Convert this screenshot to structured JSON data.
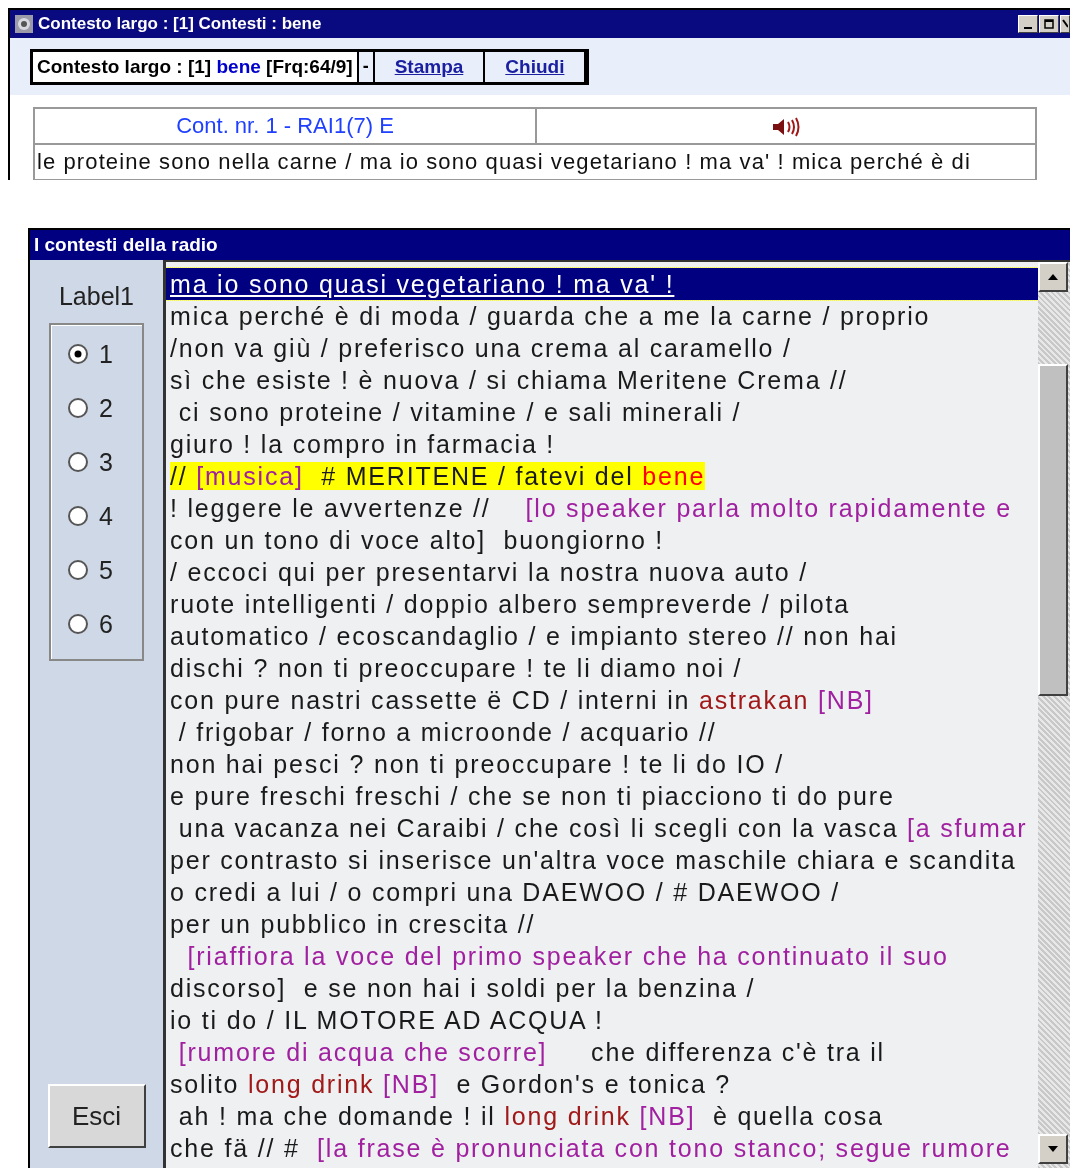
{
  "top_window": {
    "title": "Contesto largo : [1] Contesti : bene",
    "toolbar": {
      "title": "Contesto largo : [1]",
      "word": "bene",
      "frequency": "[Frq:64/9]",
      "separator": "-",
      "links": [
        "Stampa",
        "Chiudi"
      ]
    },
    "table": {
      "context_number": "Cont. nr. 1 - RAI1(7) E",
      "text": "le proteine sono nella carne / ma io sono quasi vegetariano ! ma va' ! mica perché è di"
    }
  },
  "radio_window": {
    "title": "I contesti della radio",
    "group_label": "Label1",
    "options": [
      {
        "label": "1",
        "selected": true
      },
      {
        "label": "2",
        "selected": false
      },
      {
        "label": "3",
        "selected": false
      },
      {
        "label": "4",
        "selected": false
      },
      {
        "label": "5",
        "selected": false
      },
      {
        "label": "6",
        "selected": false
      }
    ],
    "exit_button": "Esci",
    "lines": [
      {
        "selected": true,
        "highlighted": false,
        "segments": [
          {
            "kind": "text",
            "text": "ma io sono quasi vegetariano ! ma va' !"
          }
        ]
      },
      {
        "selected": false,
        "highlighted": false,
        "segments": [
          {
            "kind": "text",
            "text": "mica perché è di moda / guarda che a me la carne / proprio"
          }
        ]
      },
      {
        "selected": false,
        "highlighted": false,
        "segments": [
          {
            "kind": "text",
            "text": "/non va giù / preferisco una crema al caramello /"
          }
        ]
      },
      {
        "selected": false,
        "highlighted": false,
        "segments": [
          {
            "kind": "text",
            "text": "sì che esiste ! è nuova / si chiama Meritene Crema //"
          }
        ]
      },
      {
        "selected": false,
        "highlighted": false,
        "segments": [
          {
            "kind": "text",
            "text": " ci sono proteine / vitamine / e sali minerali /"
          }
        ]
      },
      {
        "selected": false,
        "highlighted": false,
        "segments": [
          {
            "kind": "text",
            "text": "giuro ! la compro in farmacia !"
          }
        ]
      },
      {
        "selected": false,
        "highlighted": true,
        "segments": [
          {
            "kind": "text",
            "text": "// "
          },
          {
            "kind": "note",
            "text": "[musica]"
          },
          {
            "kind": "text",
            "text": "  # MERITENE / fatevi del "
          },
          {
            "kind": "match",
            "text": "bene"
          }
        ]
      },
      {
        "selected": false,
        "highlighted": false,
        "segments": [
          {
            "kind": "text",
            "text": "! leggere le avvertenze //    "
          },
          {
            "kind": "note",
            "text": "[lo speaker parla molto rapidamente e"
          }
        ]
      },
      {
        "selected": false,
        "highlighted": false,
        "segments": [
          {
            "kind": "text",
            "text": "con un tono di voce alto]  buongiorno !"
          }
        ]
      },
      {
        "selected": false,
        "highlighted": false,
        "segments": [
          {
            "kind": "text",
            "text": "/ eccoci qui per presentarvi la nostra nuova auto /"
          }
        ]
      },
      {
        "selected": false,
        "highlighted": false,
        "segments": [
          {
            "kind": "text",
            "text": "ruote intelligenti / doppio albero sempreverde / pilota"
          }
        ]
      },
      {
        "selected": false,
        "highlighted": false,
        "segments": [
          {
            "kind": "text",
            "text": "automatico / ecoscandaglio / e impianto stereo // non hai"
          }
        ]
      },
      {
        "selected": false,
        "highlighted": false,
        "segments": [
          {
            "kind": "text",
            "text": "dischi ? non ti preoccupare ! te li diamo noi /"
          }
        ]
      },
      {
        "selected": false,
        "highlighted": false,
        "segments": [
          {
            "kind": "text",
            "text": "con pure nastri cassette ë CD / interni in "
          },
          {
            "kind": "term",
            "text": "astrakan"
          },
          {
            "kind": "note",
            "text": " [NB]"
          }
        ]
      },
      {
        "selected": false,
        "highlighted": false,
        "segments": [
          {
            "kind": "text",
            "text": " / frigobar / forno a microonde / acquario //"
          }
        ]
      },
      {
        "selected": false,
        "highlighted": false,
        "segments": [
          {
            "kind": "text",
            "text": "non hai pesci ? non ti preoccupare ! te li do IO /"
          }
        ]
      },
      {
        "selected": false,
        "highlighted": false,
        "segments": [
          {
            "kind": "text",
            "text": "e pure freschi freschi / che se non ti piacciono ti do pure"
          }
        ]
      },
      {
        "selected": false,
        "highlighted": false,
        "segments": [
          {
            "kind": "text",
            "text": " una vacanza nei Caraibi / che così li scegli con la vasca "
          },
          {
            "kind": "note",
            "text": "[a sfumar"
          }
        ]
      },
      {
        "selected": false,
        "highlighted": false,
        "segments": [
          {
            "kind": "text",
            "text": "per contrasto si inserisce un'altra voce maschile chiara e scandita"
          }
        ]
      },
      {
        "selected": false,
        "highlighted": false,
        "segments": [
          {
            "kind": "text",
            "text": "o credi a lui / o compri una DAEWOO / # DAEWOO /"
          }
        ]
      },
      {
        "selected": false,
        "highlighted": false,
        "segments": [
          {
            "kind": "text",
            "text": "per un pubblico in crescita //"
          }
        ]
      },
      {
        "selected": false,
        "highlighted": false,
        "segments": [
          {
            "kind": "note",
            "text": "  [riaffiora la voce del primo speaker che ha continuato il suo"
          }
        ]
      },
      {
        "selected": false,
        "highlighted": false,
        "segments": [
          {
            "kind": "text",
            "text": "discorso]  e se non hai i soldi per la benzina /"
          }
        ]
      },
      {
        "selected": false,
        "highlighted": false,
        "segments": [
          {
            "kind": "text",
            "text": "io ti do / IL MOTORE AD ACQUA !"
          }
        ]
      },
      {
        "selected": false,
        "highlighted": false,
        "segments": [
          {
            "kind": "note",
            "text": " [rumore di acqua che scorre]"
          },
          {
            "kind": "text",
            "text": "     che differenza c'è tra il"
          }
        ]
      },
      {
        "selected": false,
        "highlighted": false,
        "segments": [
          {
            "kind": "text",
            "text": "solito "
          },
          {
            "kind": "term",
            "text": "long drink"
          },
          {
            "kind": "note",
            "text": " [NB]"
          },
          {
            "kind": "text",
            "text": "  e Gordon's e tonica ?"
          }
        ]
      },
      {
        "selected": false,
        "highlighted": false,
        "segments": [
          {
            "kind": "text",
            "text": " ah ! ma che domande ! il "
          },
          {
            "kind": "term",
            "text": "long drink"
          },
          {
            "kind": "note",
            "text": " [NB]"
          },
          {
            "kind": "text",
            "text": "  è quella cosa"
          }
        ]
      },
      {
        "selected": false,
        "highlighted": false,
        "segments": [
          {
            "kind": "text",
            "text": "che fä // #  "
          },
          {
            "kind": "note",
            "text": "[la frase è pronunciata con tono stanco; segue rumore"
          }
        ]
      }
    ]
  }
}
